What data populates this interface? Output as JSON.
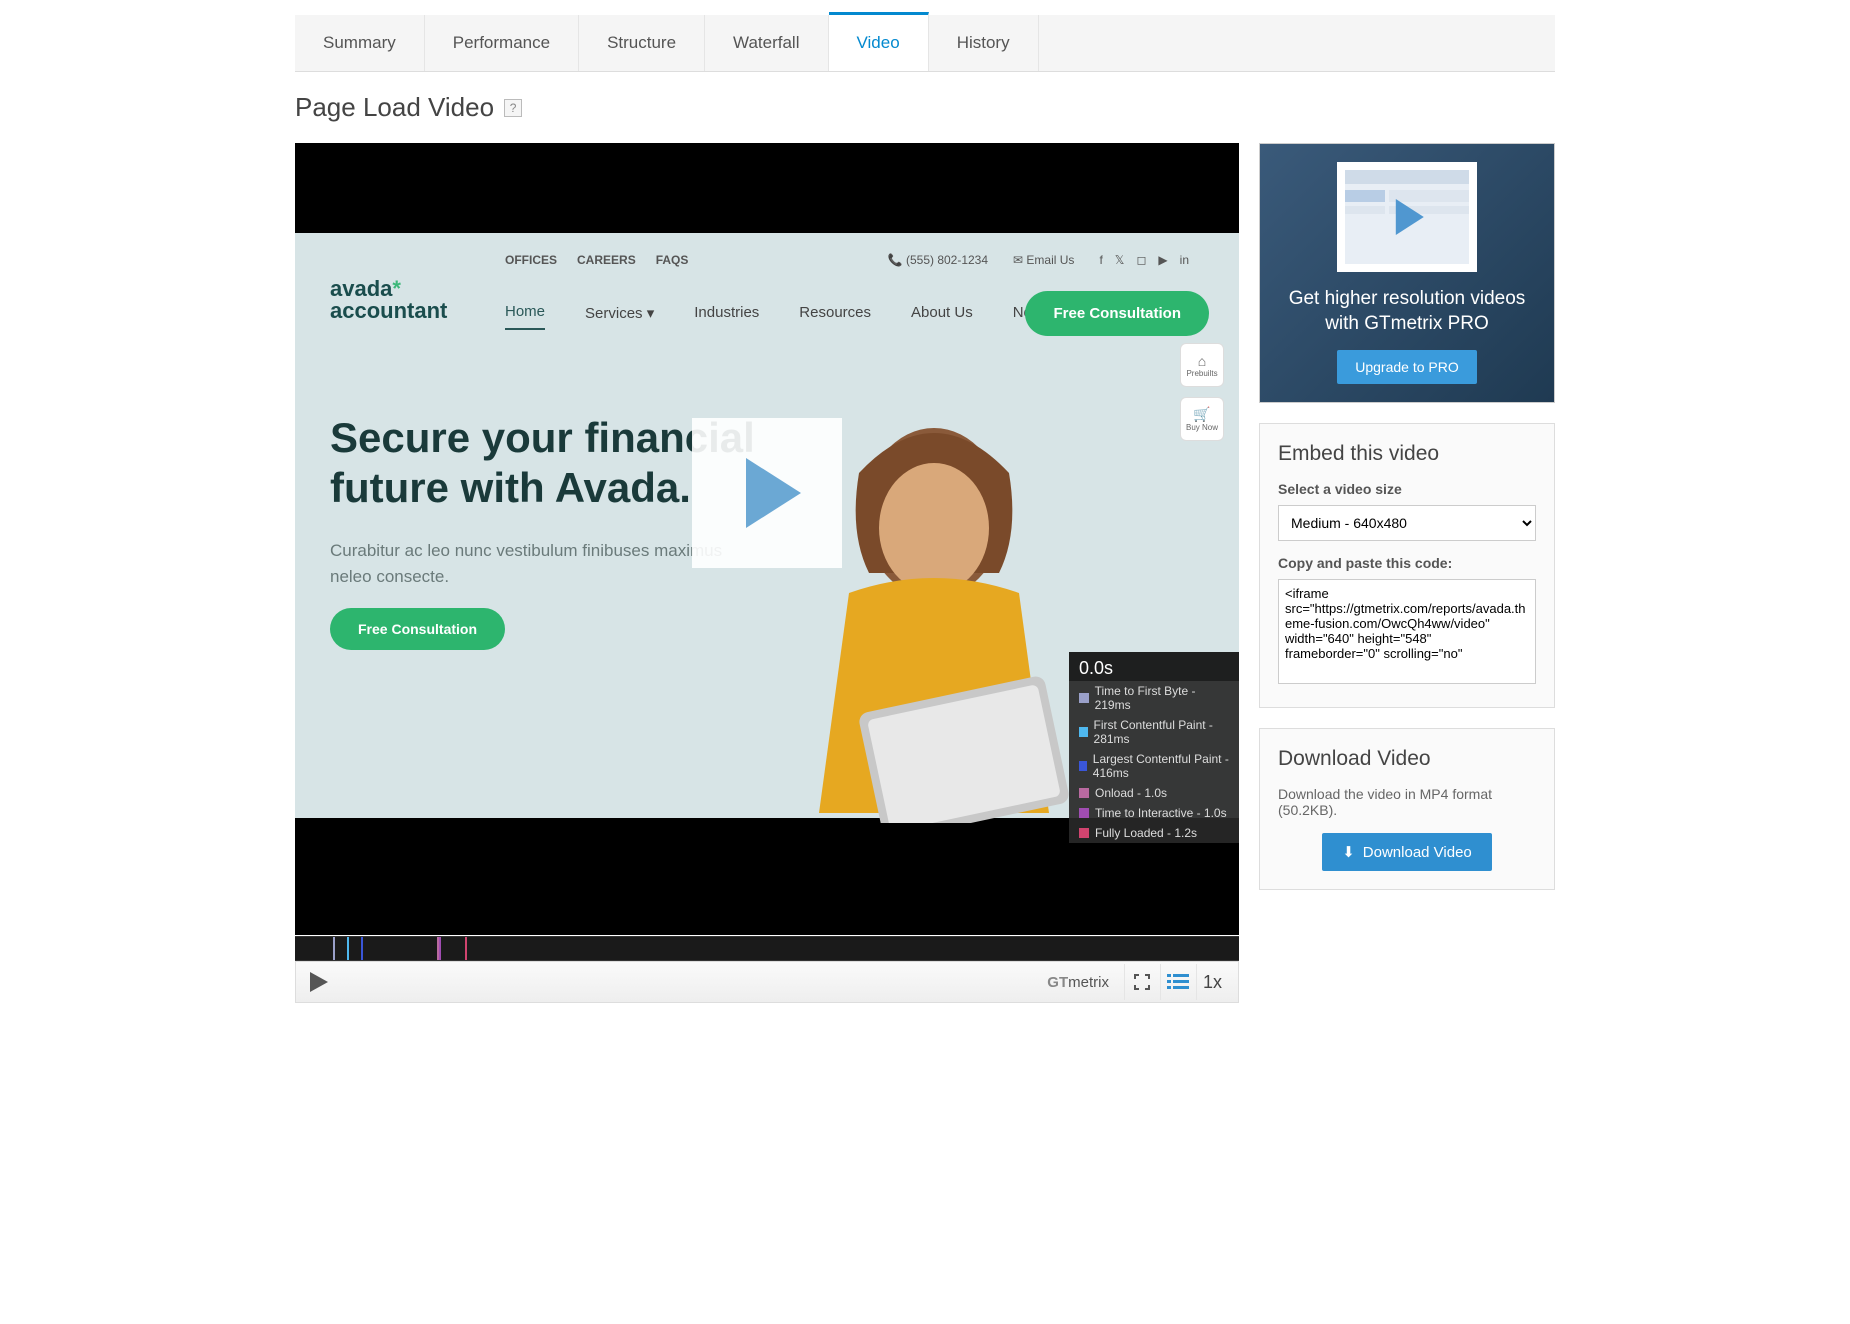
{
  "tabs": [
    {
      "label": "Summary",
      "active": false
    },
    {
      "label": "Performance",
      "active": false
    },
    {
      "label": "Structure",
      "active": false
    },
    {
      "label": "Waterfall",
      "active": false
    },
    {
      "label": "Video",
      "active": true
    },
    {
      "label": "History",
      "active": false
    }
  ],
  "page_title": "Page Load Video",
  "help_tooltip": "?",
  "preview": {
    "top_links": [
      "OFFICES",
      "CAREERS",
      "FAQS"
    ],
    "phone": "(555) 802-1234",
    "email_label": "Email Us",
    "logo_line1": "avada",
    "logo_star": "*",
    "logo_line2": "accountant",
    "nav": [
      "Home",
      "Services",
      "Industries",
      "Resources",
      "About Us",
      "News"
    ],
    "cta": "Free Consultation",
    "widgets": [
      "Prebuilts",
      "Buy Now"
    ],
    "hero_title": "Secure your financial future with Avada.",
    "hero_sub": "Curabitur ac leo nunc vestibulum finibuses maximus neleo consecte.",
    "hero_cta": "Free Consultation"
  },
  "metrics": {
    "time": "0.0s",
    "items": [
      {
        "color": "#9aa0c9",
        "label": "Time to First Byte - 219ms"
      },
      {
        "color": "#4fb8ef",
        "label": "First Contentful Paint - 281ms"
      },
      {
        "color": "#3a56d8",
        "label": "Largest Contentful Paint - 416ms"
      },
      {
        "color": "#b96aa0",
        "label": "Onload - 1.0s"
      },
      {
        "color": "#a04db2",
        "label": "Time to Interactive - 1.0s"
      },
      {
        "color": "#d1446f",
        "label": "Fully Loaded - 1.2s"
      }
    ]
  },
  "controls": {
    "brand": "GTmetrix",
    "speed": "1x"
  },
  "promo": {
    "text": "Get higher resolution videos with GTmetrix PRO",
    "button": "Upgrade to PRO"
  },
  "embed": {
    "title": "Embed this video",
    "size_label": "Select a video size",
    "size_value": "Medium - 640x480",
    "code_label": "Copy and paste this code:",
    "code": "<iframe src=\"https://gtmetrix.com/reports/avada.theme-fusion.com/OwcQh4ww/video\" width=\"640\" height=\"548\" frameborder=\"0\" scrolling=\"no\""
  },
  "download": {
    "title": "Download Video",
    "desc": "Download the video in MP4 format (50.2KB).",
    "button": "Download Video"
  }
}
